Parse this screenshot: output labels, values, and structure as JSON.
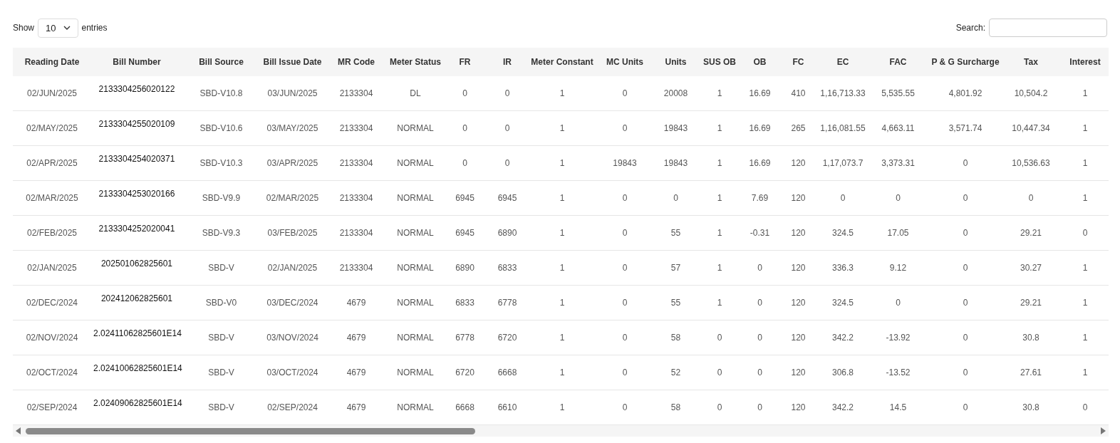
{
  "length_control": {
    "label_before": "Show",
    "value": "10",
    "label_after": "entries"
  },
  "search": {
    "label": "Search:"
  },
  "table": {
    "columns": [
      "Reading Date",
      "Bill Number",
      "Bill Source",
      "Bill Issue Date",
      "MR Code",
      "Meter Status",
      "FR",
      "IR",
      "Meter Constant",
      "MC Units",
      "Units",
      "SUS OB",
      "OB",
      "FC",
      "EC",
      "FAC",
      "P & G Surcharge",
      "Tax",
      "Interest"
    ],
    "rows": [
      [
        "02/JUN/2025",
        "2133304256020122",
        "SBD-V10.8",
        "03/JUN/2025",
        "2133304",
        "DL",
        "0",
        "0",
        "1",
        "0",
        "20008",
        "1",
        "16.69",
        "410",
        "1,16,713.33",
        "5,535.55",
        "4,801.92",
        "10,504.2",
        "1"
      ],
      [
        "02/MAY/2025",
        "2133304255020109",
        "SBD-V10.6",
        "03/MAY/2025",
        "2133304",
        "NORMAL",
        "0",
        "0",
        "1",
        "0",
        "19843",
        "1",
        "16.69",
        "265",
        "1,16,081.55",
        "4,663.11",
        "3,571.74",
        "10,447.34",
        "1"
      ],
      [
        "02/APR/2025",
        "2133304254020371",
        "SBD-V10.3",
        "03/APR/2025",
        "2133304",
        "NORMAL",
        "0",
        "0",
        "1",
        "19843",
        "19843",
        "1",
        "16.69",
        "120",
        "1,17,073.7",
        "3,373.31",
        "0",
        "10,536.63",
        "1"
      ],
      [
        "02/MAR/2025",
        "2133304253020166",
        "SBD-V9.9",
        "02/MAR/2025",
        "2133304",
        "NORMAL",
        "6945",
        "6945",
        "1",
        "0",
        "0",
        "1",
        "7.69",
        "120",
        "0",
        "0",
        "0",
        "0",
        "1"
      ],
      [
        "02/FEB/2025",
        "2133304252020041",
        "SBD-V9.3",
        "03/FEB/2025",
        "2133304",
        "NORMAL",
        "6945",
        "6890",
        "1",
        "0",
        "55",
        "1",
        "-0.31",
        "120",
        "324.5",
        "17.05",
        "0",
        "29.21",
        "0"
      ],
      [
        "02/JAN/2025",
        "202501062825601",
        "SBD-V",
        "02/JAN/2025",
        "2133304",
        "NORMAL",
        "6890",
        "6833",
        "1",
        "0",
        "57",
        "1",
        "0",
        "120",
        "336.3",
        "9.12",
        "0",
        "30.27",
        "1"
      ],
      [
        "02/DEC/2024",
        "202412062825601",
        "SBD-V0",
        "03/DEC/2024",
        "4679",
        "NORMAL",
        "6833",
        "6778",
        "1",
        "0",
        "55",
        "1",
        "0",
        "120",
        "324.5",
        "0",
        "0",
        "29.21",
        "1"
      ],
      [
        "02/NOV/2024",
        "2.02411062825601E14",
        "SBD-V",
        "03/NOV/2024",
        "4679",
        "NORMAL",
        "6778",
        "6720",
        "1",
        "0",
        "58",
        "0",
        "0",
        "120",
        "342.2",
        "-13.92",
        "0",
        "30.8",
        "1"
      ],
      [
        "02/OCT/2024",
        "2.02410062825601E14",
        "SBD-V",
        "03/OCT/2024",
        "4679",
        "NORMAL",
        "6720",
        "6668",
        "1",
        "0",
        "52",
        "0",
        "0",
        "120",
        "306.8",
        "-13.52",
        "0",
        "27.61",
        "1"
      ],
      [
        "02/SEP/2024",
        "2.02409062825601E14",
        "SBD-V",
        "02/SEP/2024",
        "4679",
        "NORMAL",
        "6668",
        "6610",
        "1",
        "0",
        "58",
        "0",
        "0",
        "120",
        "342.2",
        "14.5",
        "0",
        "30.8",
        "0"
      ]
    ]
  }
}
